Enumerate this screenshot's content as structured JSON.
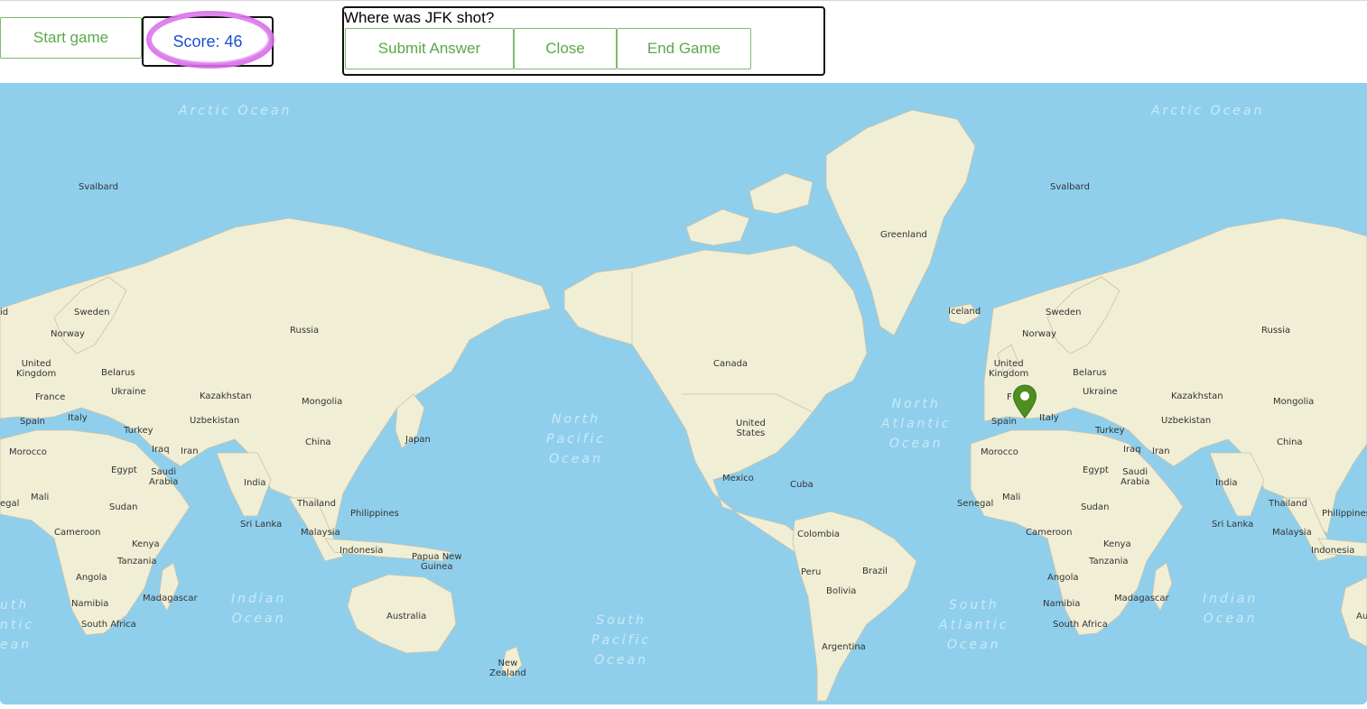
{
  "toolbar": {
    "start_label": "Start game",
    "score_label": "Score: 46",
    "question": "Where was JFK shot?",
    "submit_label": "Submit Answer",
    "close_label": "Close",
    "end_label": "End Game"
  },
  "colors": {
    "button_border": "#7cbb6e",
    "button_text": "#5aa84a",
    "score_text": "#1a4fd6",
    "highlight_ring": "#d86ee8",
    "ocean": "#8fcfec",
    "land": "#f1eed6",
    "marker": "#4e8f1f"
  },
  "map": {
    "marker_icon": "map-pin-icon",
    "oceans": {
      "arctic1": "Arctic Ocean",
      "arctic2": "Arctic Ocean",
      "north_pacific": "North\nPacific\nOcean",
      "north_atlantic": "North\nAtlantic\nOcean",
      "south_pacific": "South\nPacific\nOcean",
      "south_atlantic": "South\nAtlantic\nOcean",
      "indian1": "Indian\nOcean",
      "indian2": "Indian\nOcean",
      "south_atlantic_left": "uth\nntic\nean"
    },
    "labels": {
      "svalbard1": "Svalbard",
      "svalbard2": "Svalbard",
      "greenland": "Greenland",
      "iceland": "Iceland",
      "id_left": "id",
      "sweden1": "Sweden",
      "sweden2": "Sweden",
      "norway1": "Norway",
      "norway2": "Norway",
      "russia1": "Russia",
      "russia2": "Russia",
      "canada": "Canada",
      "united_states": "United\nStates",
      "uk1": "United\nKingdom",
      "uk2": "United\nKingdom",
      "belarus1": "Belarus",
      "belarus2": "Belarus",
      "ukraine1": "Ukraine",
      "ukraine2": "Ukraine",
      "france1": "France",
      "france2": "F",
      "kazakhstan1": "Kazakhstan",
      "kazakhstan2": "Kazakhstan",
      "mongolia1": "Mongolia",
      "mongolia2": "Mongolia",
      "spain1": "Spain",
      "spain2": "Spain",
      "italy1": "Italy",
      "italy2": "Italy",
      "uzbekistan1": "Uzbekistan",
      "uzbekistan2": "Uzbekistan",
      "turkey1": "Turkey",
      "turkey2": "Turkey",
      "china1": "China",
      "china2": "China",
      "japan": "Japan",
      "morocco1": "Morocco",
      "morocco2": "Morocco",
      "iraq1": "Iraq",
      "iraq2": "Iraq",
      "iran1": "Iran",
      "iran2": "Iran",
      "egypt1": "Egypt",
      "egypt2": "Egypt",
      "saudi1": "Saudi\nArabia",
      "saudi2": "Saudi\nArabia",
      "india1": "India",
      "india2": "India",
      "mexico": "Mexico",
      "cuba": "Cuba",
      "mali1": "Mali",
      "mali2": "Mali",
      "sudan1": "Sudan",
      "sudan2": "Sudan",
      "thailand1": "Thailand",
      "thailand2": "Thailand",
      "senegal1": "egal",
      "senegal2": "Senegal",
      "philippines1": "Philippines",
      "philippines2": "Philippines",
      "srilanka1": "Sri Lanka",
      "srilanka2": "Sri Lanka",
      "cameroon1": "Cameroon",
      "cameroon2": "Cameroon",
      "malaysia1": "Malaysia",
      "malaysia2": "Malaysia",
      "kenya1": "Kenya",
      "kenya2": "Kenya",
      "indonesia1": "Indonesia",
      "indonesia2": "Indonesia",
      "png": "Papua New\nGuinea",
      "colombia": "Colombia",
      "tanzania1": "Tanzania",
      "tanzania2": "Tanzania",
      "peru": "Peru",
      "brazil": "Brazil",
      "angola1": "Angola",
      "angola2": "Angola",
      "bolivia": "Bolivia",
      "madagascar1": "Madagascar",
      "madagascar2": "Madagascar",
      "namibia1": "Namibia",
      "namibia2": "Namibia",
      "australia": "Australia",
      "au_right": "Au",
      "southafrica1": "South Africa",
      "southafrica2": "South Africa",
      "argentina": "Argentina",
      "newzealand": "New\nZealand"
    }
  }
}
